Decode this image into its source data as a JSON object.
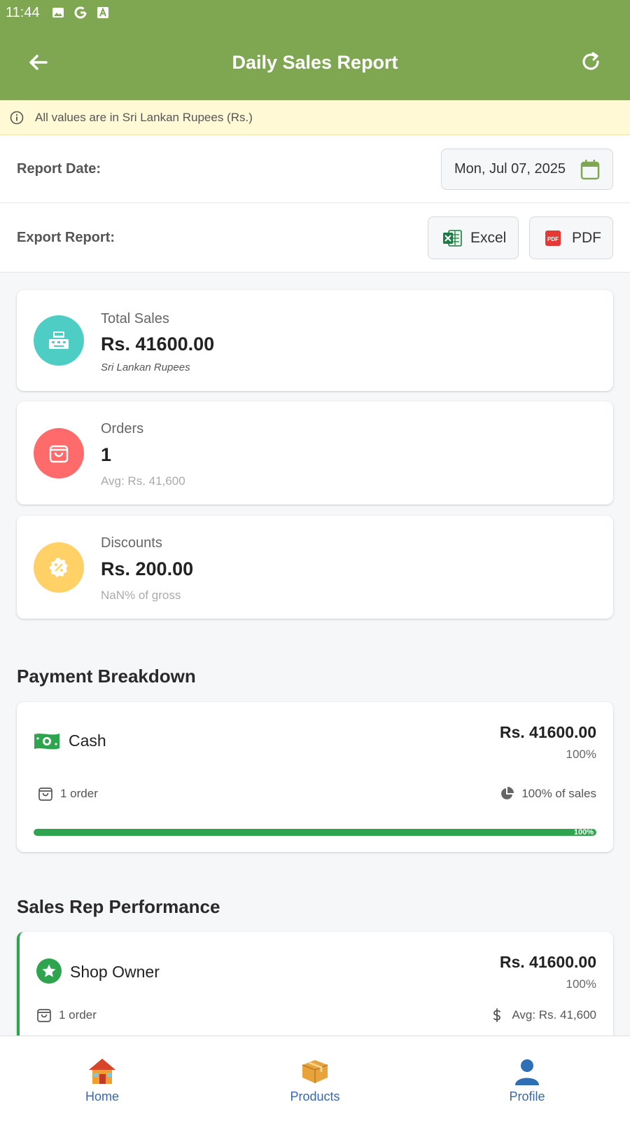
{
  "status_bar": {
    "time": "11:44",
    "icons": [
      "image-icon",
      "google-icon",
      "a-icon"
    ]
  },
  "app_bar": {
    "title": "Daily Sales Report",
    "back_icon": "arrow-left-icon",
    "refresh_icon": "refresh-icon"
  },
  "notice": {
    "text": "All values are in Sri Lankan Rupees (Rs.)",
    "icon": "info-icon"
  },
  "report_date": {
    "label": "Report Date:",
    "value": "Mon, Jul 07, 2025",
    "icon": "calendar-icon"
  },
  "export": {
    "label": "Export Report:",
    "excel_label": "Excel",
    "pdf_label": "PDF"
  },
  "stats": [
    {
      "label": "Total Sales",
      "value": "Rs. 41600.00",
      "sub": "Sri Lankan Rupees",
      "icon": "cash-register-icon",
      "color": "#4ecdc4"
    },
    {
      "label": "Orders",
      "value": "1",
      "sub": "Avg: Rs. 41,600",
      "icon": "shopping-bag-icon",
      "color": "#ff6b6b"
    },
    {
      "label": "Discounts",
      "value": "Rs. 200.00",
      "sub": "NaN% of gross",
      "icon": "discount-badge-icon",
      "color": "#ffd166"
    }
  ],
  "payment_breakdown": {
    "title": "Payment Breakdown",
    "items": [
      {
        "method": "Cash",
        "amount": "Rs. 41600.00",
        "percent": "100%",
        "orders": "1 order",
        "share": "100% of sales",
        "bar_label": "100%",
        "bar_fraction": 1.0
      }
    ]
  },
  "sales_reps": {
    "title": "Sales Rep Performance",
    "items": [
      {
        "name": "Shop Owner",
        "amount": "Rs. 41600.00",
        "percent": "100%",
        "orders": "1 order",
        "avg": "Avg: Rs. 41,600"
      }
    ]
  },
  "bottom_nav": {
    "items": [
      {
        "label": "Home",
        "icon": "house-icon"
      },
      {
        "label": "Products",
        "icon": "package-icon"
      },
      {
        "label": "Profile",
        "icon": "person-icon"
      }
    ]
  },
  "colors": {
    "primary": "#7fa752",
    "accent_green": "#2ea44f",
    "notice_bg": "#fff9d6",
    "nav_label": "#3a66b0"
  }
}
